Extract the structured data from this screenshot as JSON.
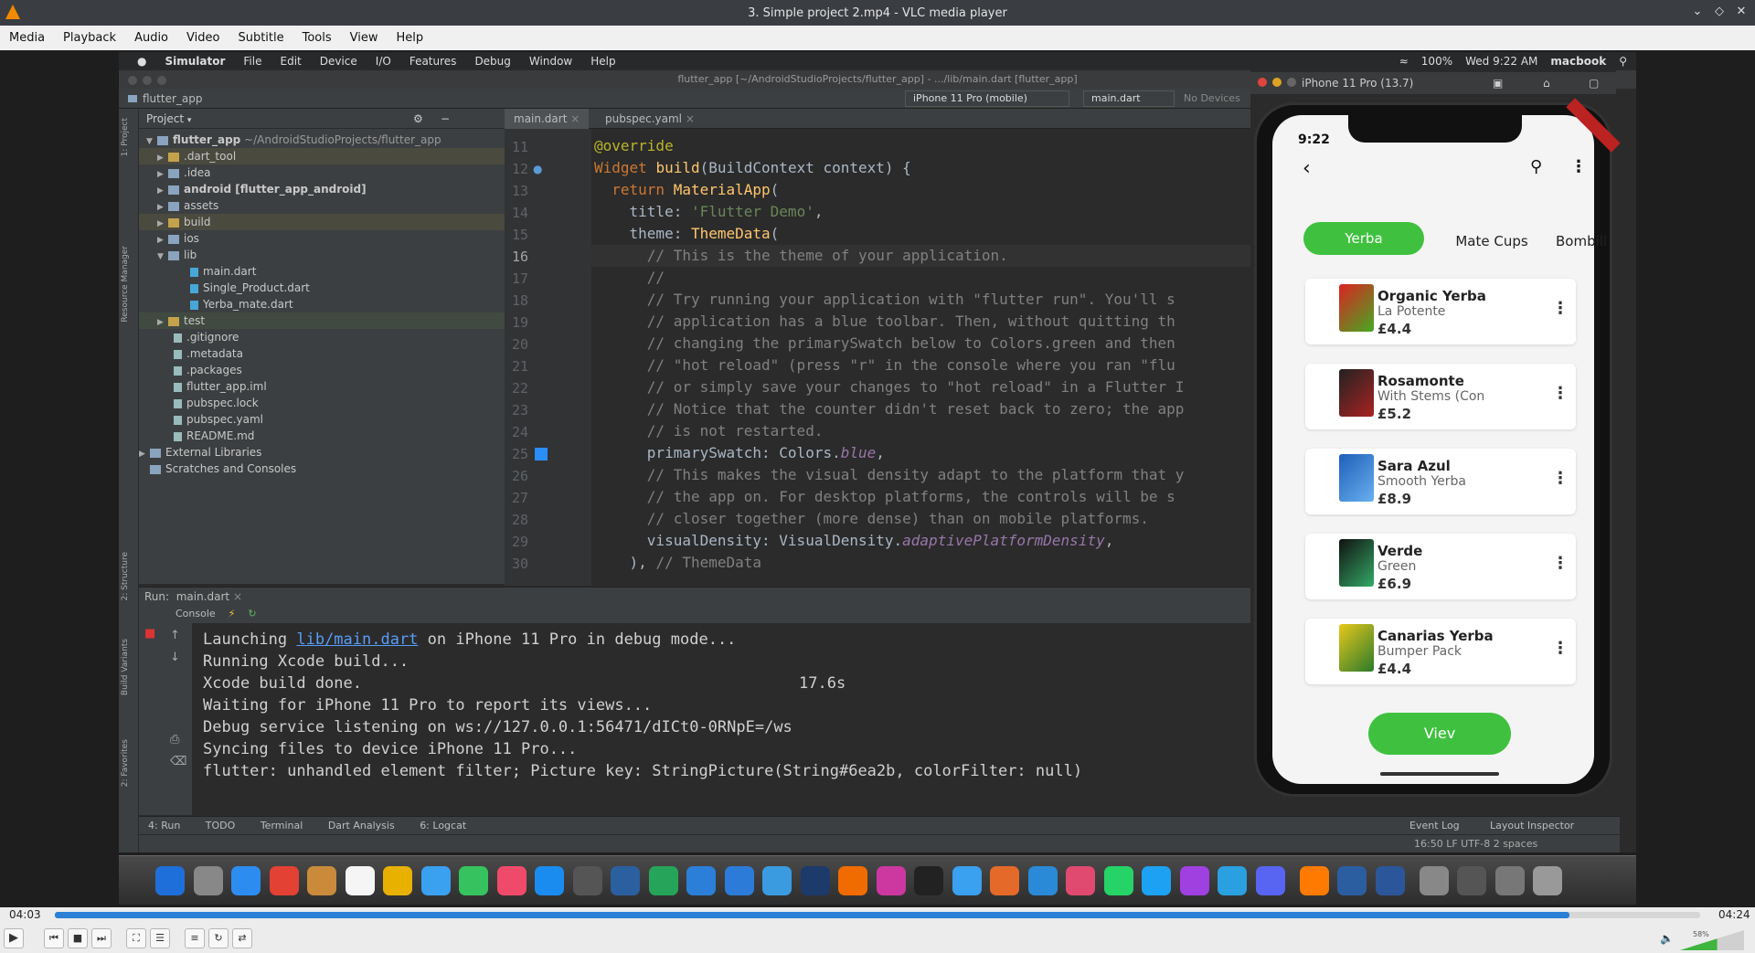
{
  "window": {
    "title": "3. Simple project 2.mp4 - VLC media player"
  },
  "menu": [
    "Media",
    "Playback",
    "Audio",
    "Video",
    "Subtitle",
    "Tools",
    "View",
    "Help"
  ],
  "mac_menu": {
    "app": "Simulator",
    "items": [
      "File",
      "Edit",
      "Device",
      "I/O",
      "Features",
      "Debug",
      "Window",
      "Help"
    ],
    "battery": "100%",
    "clock": "Wed 9:22 AM",
    "user": "macbook"
  },
  "ide": {
    "title": "flutter_app [~/AndroidStudioProjects/flutter_app] - .../lib/main.dart [flutter_app]",
    "breadcrumb": "flutter_app",
    "device_selector": "iPhone 11 Pro (mobile)",
    "run_config": "main.dart",
    "no_devices": "No Devices",
    "project_label": "Project",
    "side_tabs": [
      "1: Project",
      "Resource Manager",
      "2: Structure",
      "Build Variants",
      "2: Favorites"
    ],
    "tree": [
      {
        "label": "flutter_app",
        "extra": "~/AndroidStudioProjects/flutter_app"
      },
      {
        "label": ".dart_tool"
      },
      {
        "label": ".idea"
      },
      {
        "label": "android [flutter_app_android]"
      },
      {
        "label": "assets"
      },
      {
        "label": "build"
      },
      {
        "label": "ios"
      },
      {
        "label": "lib"
      },
      {
        "label": "main.dart"
      },
      {
        "label": "Single_Product.dart"
      },
      {
        "label": "Yerba_mate.dart"
      },
      {
        "label": "test"
      },
      {
        "label": ".gitignore"
      },
      {
        "label": ".metadata"
      },
      {
        "label": ".packages"
      },
      {
        "label": "flutter_app.iml"
      },
      {
        "label": "pubspec.lock"
      },
      {
        "label": "pubspec.yaml"
      },
      {
        "label": "README.md"
      },
      {
        "label": "External Libraries"
      },
      {
        "label": "Scratches and Consoles"
      }
    ],
    "tabs": [
      "main.dart",
      "pubspec.yaml"
    ],
    "line_numbers": [
      "11",
      "12",
      "13",
      "14",
      "15",
      "16",
      "17",
      "18",
      "19",
      "20",
      "21",
      "22",
      "23",
      "24",
      "25",
      "26",
      "27",
      "28",
      "29",
      "30"
    ],
    "code": {
      "l11": "@override",
      "l12a": "Widget ",
      "l12b": "build",
      "l12c": "(BuildContext context) {",
      "l13a": "  return ",
      "l13b": "MaterialApp",
      "l13c": "(",
      "l14a": "    title: ",
      "l14b": "'Flutter Demo'",
      "l14c": ",",
      "l15a": "    theme: ",
      "l15b": "ThemeData",
      "l15c": "(",
      "l16": "      // This is the theme of your application.",
      "l17": "      //",
      "l18": "      // Try running your application with \"flutter run\". You'll s",
      "l19": "      // application has a blue toolbar. Then, without quitting th",
      "l20": "      // changing the primarySwatch below to Colors.green and then",
      "l21": "      // \"hot reload\" (press \"r\" in the console where you ran \"flu",
      "l22": "      // or simply save your changes to \"hot reload\" in a Flutter I",
      "l23": "      // Notice that the counter didn't reset back to zero; the app",
      "l24": "      // is not restarted.",
      "l25a": "      primarySwatch: Colors.",
      "l25b": "blue",
      "l25c": ",",
      "l26": "      // This makes the visual density adapt to the platform that y",
      "l27": "      // the app on. For desktop platforms, the controls will be s",
      "l28": "      // closer together (more dense) than on mobile platforms.",
      "l29a": "      visualDensity: VisualDensity.",
      "l29b": "adaptivePlatformDensity",
      "l29c": ",",
      "l30a": "    ), ",
      "l30b": "// ThemeData"
    },
    "run_label": "Run:",
    "run_tab": "main.dart",
    "console_label": "Console",
    "console": {
      "c1a": "Launching ",
      "c1b": "lib/main.dart",
      "c1c": " on iPhone 11 Pro in debug mode...",
      "c2": "Running Xcode build...",
      "c3a": "Xcode build done.",
      "c3b": "17.6s",
      "c4": "Waiting for iPhone 11 Pro to report its views...",
      "c5": "Debug service listening on ws://127.0.0.1:56471/dICt0-0RNpE=/ws",
      "c6": "Syncing files to device iPhone 11 Pro...",
      "c7": "flutter: unhandled element filter; Picture key: StringPicture(String#6ea2b, colorFilter: null)"
    },
    "bottom_tabs": [
      "4: Run",
      "TODO",
      "Terminal",
      "Dart Analysis",
      "6: Logcat"
    ],
    "bottom_right": [
      "Event Log",
      "Layout Inspector"
    ],
    "status": "16:50  LF  UTF-8  2 spaces"
  },
  "simulator": {
    "title": "iPhone 11 Pro (13.7)",
    "time": "9:22",
    "categories": [
      "Yerba",
      "Mate Cups",
      "Bombill"
    ],
    "products": [
      {
        "name": "Organic Yerba",
        "sub": "La Potente",
        "price": "£4.4"
      },
      {
        "name": "Rosamonte",
        "sub": "With Stems (Con",
        "price": "£5.2"
      },
      {
        "name": "Sara Azul",
        "sub": "Smooth Yerba",
        "price": "£8.9"
      },
      {
        "name": "Verde",
        "sub": "Green",
        "price": "£6.9"
      },
      {
        "name": "Canarias Yerba",
        "sub": "Bumper Pack",
        "price": "£4.4"
      }
    ],
    "view_button": "Viev"
  },
  "player": {
    "elapsed": "04:03",
    "total": "04:24",
    "progress": 0.9208,
    "volume": "58%"
  },
  "colors": {
    "accent_green": "#3fc13f",
    "seek_blue": "#2a7fd6"
  }
}
